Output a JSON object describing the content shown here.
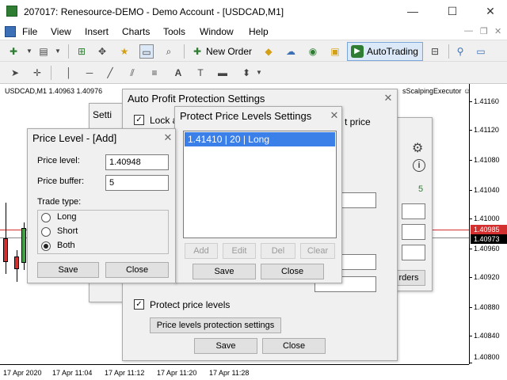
{
  "window": {
    "title": "207017: Renesource-DEMO - Demo Account - [USDCAD,M1]",
    "minimize": "—",
    "maximize": "☐",
    "close": "✕"
  },
  "menu": {
    "items": [
      "File",
      "View",
      "Insert",
      "Charts",
      "Tools",
      "Window",
      "Help"
    ],
    "mdi_minimize": "—",
    "mdi_restore": "❐",
    "mdi_close": "✕"
  },
  "toolbar": {
    "new_order": "New Order",
    "autotrading": "AutoTrading"
  },
  "chart": {
    "symbol_header": "USDCAD,M1  1.40963  1.40976",
    "expert_name": "sScalpingExecutor ☺",
    "price_labels": [
      "1.41160",
      "1.41120",
      "1.41080",
      "1.41040",
      "1.41000",
      "1.40960",
      "1.40920",
      "1.40880",
      "1.40840",
      "1.40800"
    ],
    "bid_price": "1.40985",
    "ask_price": "1.40973",
    "time_labels": [
      "17 Apr 2020",
      "17 Apr 11:04",
      "17 Apr 11:12",
      "17 Apr 11:20",
      "17 Apr 11:28"
    ],
    "colors": {
      "bid": "#d32f2f",
      "ask": "#000000"
    }
  },
  "settings_dialog": {
    "title": "Setti"
  },
  "right_panel": {
    "value": "5",
    "orders_label": "rders"
  },
  "auto_profit_dialog": {
    "title": "Auto Profit Protection Settings",
    "lock_label": "Lock a",
    "price_partial": "t price",
    "protect_checkbox": "Protect price levels",
    "protect_checked": true,
    "lock_checked": true,
    "levels_button": "Price levels protection settings",
    "save": "Save",
    "close": "Close",
    "close_icon": "✕"
  },
  "protect_levels_dialog": {
    "title": "Protect Price Levels Settings",
    "levels": [
      "1.41410 | 20 | Long"
    ],
    "selected_index": 0,
    "add": "Add",
    "edit": "Edit",
    "del": "Del",
    "clear": "Clear",
    "save": "Save",
    "close": "Close",
    "close_icon": "✕"
  },
  "price_level_dialog": {
    "title": "Price Level - [Add]",
    "price_level_label": "Price level:",
    "price_level_value": "1.40948",
    "price_buffer_label": "Price buffer:",
    "price_buffer_value": "5",
    "trade_type_label": "Trade type:",
    "options": [
      "Long",
      "Short",
      "Both"
    ],
    "selected_option": "Both",
    "save": "Save",
    "close": "Close",
    "close_icon": "✕"
  }
}
